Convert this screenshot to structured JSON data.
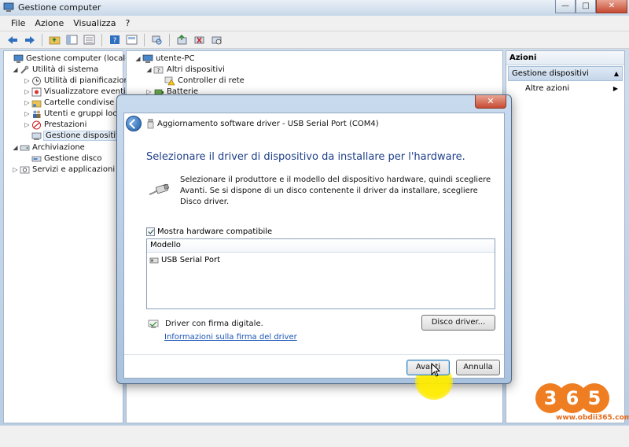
{
  "window": {
    "title": "Gestione computer",
    "buttons": {
      "minimize": "—",
      "maximize": "□",
      "close": "✕"
    }
  },
  "menu": [
    "File",
    "Azione",
    "Visualizza",
    "?"
  ],
  "left_tree": [
    {
      "label": "Gestione computer (locale)",
      "icon": "computer-management-icon",
      "level": 0,
      "expander": ""
    },
    {
      "label": "Utilità di sistema",
      "icon": "tools-icon",
      "level": 1,
      "expander": "◢"
    },
    {
      "label": "Utilità di pianificazione",
      "icon": "clock-icon",
      "level": 2,
      "expander": "▷"
    },
    {
      "label": "Visualizzatore eventi",
      "icon": "event-viewer-icon",
      "level": 2,
      "expander": "▷"
    },
    {
      "label": "Cartelle condivise",
      "icon": "shared-folder-icon",
      "level": 2,
      "expander": "▷"
    },
    {
      "label": "Utenti e gruppi locali",
      "icon": "users-icon",
      "level": 2,
      "expander": "▷"
    },
    {
      "label": "Prestazioni",
      "icon": "performance-icon",
      "level": 2,
      "expander": "▷"
    },
    {
      "label": "Gestione dispositivi",
      "icon": "device-manager-icon",
      "level": 2,
      "expander": "",
      "selected": true
    },
    {
      "label": "Archiviazione",
      "icon": "storage-icon",
      "level": 1,
      "expander": "◢"
    },
    {
      "label": "Gestione disco",
      "icon": "disk-icon",
      "level": 2,
      "expander": ""
    },
    {
      "label": "Servizi e applicazioni",
      "icon": "services-icon",
      "level": 1,
      "expander": "▷"
    }
  ],
  "center_tree": [
    {
      "label": "utente-PC",
      "icon": "computer-icon",
      "level": 0,
      "expander": "◢"
    },
    {
      "label": "Altri dispositivi",
      "icon": "unknown-device-icon",
      "level": 1,
      "expander": "◢"
    },
    {
      "label": "Controller di rete",
      "icon": "warning-device-icon",
      "level": 2,
      "expander": ""
    },
    {
      "label": "Batterie",
      "icon": "battery-icon",
      "level": 1,
      "expander": "▷"
    }
  ],
  "actions": {
    "header": "Azioni",
    "section": "Gestione dispositivi",
    "more": "Altre azioni"
  },
  "dialog": {
    "title": "Aggiornamento software driver - USB Serial Port (COM4)",
    "close": "✕",
    "heading": "Selezionare il driver di dispositivo da installare per l'hardware.",
    "description": "Selezionare il produttore e il modello del dispositivo hardware, quindi scegliere Avanti. Se si dispone di un disco contenente il driver da installare, scegliere Disco driver.",
    "checkbox_label": "Mostra hardware compatibile",
    "checkbox_checked": true,
    "list_header": "Modello",
    "list_items": [
      "USB Serial Port"
    ],
    "signed_text": "Driver con firma digitale.",
    "signed_link": "Informazioni sulla firma del driver",
    "disk_button": "Disco driver...",
    "next_button": "Avanti",
    "cancel_button": "Annulla"
  },
  "watermark": {
    "logo_text": "365",
    "site": "www.obdii365.com"
  },
  "colors": {
    "heading": "#1e3e8a",
    "link": "#1a55b5",
    "highlight": "#ffec00",
    "watermark": "#e26a1a"
  }
}
